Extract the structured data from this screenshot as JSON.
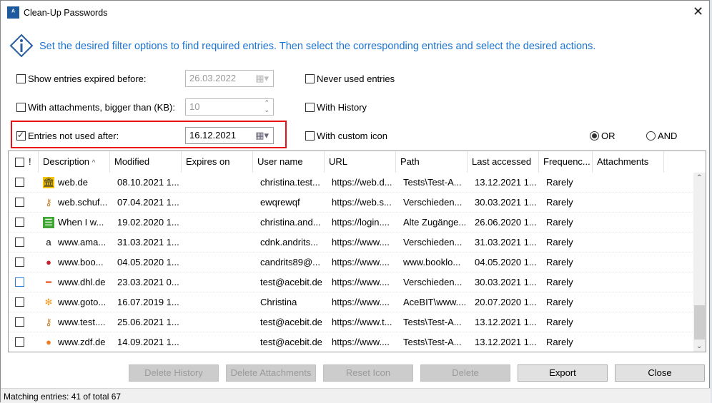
{
  "window": {
    "title": "Clean-Up Passwords",
    "close": "✕"
  },
  "info": "Set the desired filter options to find required entries. Then select the corresponding entries and select the desired actions.",
  "filters": {
    "expired": {
      "label": "Show entries expired before:",
      "checked": false,
      "value": "26.03.2022"
    },
    "attachments": {
      "label": "With attachments, bigger than (KB):",
      "checked": false,
      "value": "10"
    },
    "not_used": {
      "label": "Entries not used after:",
      "checked": true,
      "value": "16.12.2021"
    },
    "never_used": {
      "label": "Never used entries",
      "checked": false
    },
    "history": {
      "label": "With History",
      "checked": false
    },
    "custom_icon": {
      "label": "With custom icon",
      "checked": false
    },
    "logic": {
      "or": "OR",
      "and": "AND",
      "selected": "OR"
    }
  },
  "table": {
    "columns": [
      "!",
      "Description",
      "Modified",
      "Expires on",
      "User name",
      "URL",
      "Path",
      "Last accessed",
      "Frequenc...",
      "Attachments"
    ],
    "sort_indicator": "^",
    "rows": [
      {
        "icon": "bank-icon",
        "desc": "web.de",
        "modified": "08.10.2021 1...",
        "expires": "",
        "user": "christina.test...",
        "url": "https://web.d...",
        "path": "Tests\\Test-A...",
        "last": "13.12.2021 1...",
        "freq": "Rarely",
        "att": ""
      },
      {
        "icon": "key-icon",
        "desc": "web.schuf...",
        "modified": "07.04.2021 1...",
        "expires": "",
        "user": "ewqrewqf",
        "url": "https://web.s...",
        "path": "Verschieden...",
        "last": "30.03.2021 1...",
        "freq": "Rarely",
        "att": ""
      },
      {
        "icon": "document-icon",
        "desc": "When I w...",
        "modified": "19.02.2020 1...",
        "expires": "",
        "user": "christina.and...",
        "url": "https://login....",
        "path": "Alte Zugänge...",
        "last": "26.06.2020 1...",
        "freq": "Rarely",
        "att": ""
      },
      {
        "icon": "amazon-icon",
        "desc": "www.ama...",
        "modified": "31.03.2021 1...",
        "expires": "",
        "user": "cdnk.andrits...",
        "url": "https://www....",
        "path": "Verschieden...",
        "last": "31.03.2021 1...",
        "freq": "Rarely",
        "att": ""
      },
      {
        "icon": "booklooker-icon",
        "desc": "www.boo...",
        "modified": "04.05.2020 1...",
        "expires": "",
        "user": "candrits89@...",
        "url": "https://www....",
        "path": "www.booklo...",
        "last": "04.05.2020 1...",
        "freq": "Rarely",
        "att": ""
      },
      {
        "icon": "dhl-icon",
        "desc": "www.dhl.de",
        "modified": "23.03.2021 0...",
        "expires": "",
        "user": "test@acebit.de",
        "url": "https://www....",
        "path": "Verschieden...",
        "last": "30.03.2021 1...",
        "freq": "Rarely",
        "att": ""
      },
      {
        "icon": "gotomeeting-icon",
        "desc": "www.goto...",
        "modified": "16.07.2019 1...",
        "expires": "",
        "user": "Christina",
        "url": "https://www....",
        "path": "AceBIT\\www....",
        "last": "20.07.2020 1...",
        "freq": "Rarely",
        "att": ""
      },
      {
        "icon": "key-icon",
        "desc": "www.test....",
        "modified": "25.06.2021 1...",
        "expires": "",
        "user": "test@acebit.de",
        "url": "https://www.t...",
        "path": "Tests\\Test-A...",
        "last": "13.12.2021 1...",
        "freq": "Rarely",
        "att": ""
      },
      {
        "icon": "zdf-icon",
        "desc": "www.zdf.de",
        "modified": "14.09.2021 1...",
        "expires": "",
        "user": "test@acebit.de",
        "url": "https://www....",
        "path": "Tests\\Test-A...",
        "last": "13.12.2021 1...",
        "freq": "Rarely",
        "att": ""
      }
    ]
  },
  "buttons": {
    "delete_history": "Delete History",
    "delete_attachments": "Delete Attachments",
    "reset_icon": "Reset Icon",
    "delete": "Delete",
    "export": "Export",
    "close": "Close"
  },
  "status": "Matching entries: 41 of total 67"
}
